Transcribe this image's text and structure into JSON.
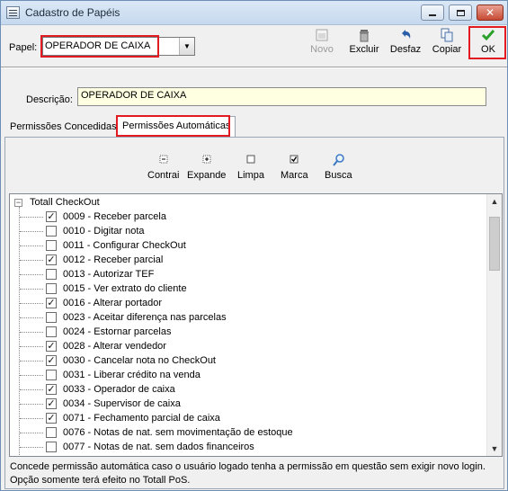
{
  "window": {
    "title": "Cadastro de Papéis"
  },
  "toolbar": {
    "papel_label": "Papel:",
    "papel_value": "OPERADOR DE CAIXA",
    "novo_label": "Novo",
    "excluir_label": "Excluir",
    "desfaz_label": "Desfaz",
    "copiar_label": "Copiar",
    "ok_label": "OK"
  },
  "descricao": {
    "label": "Descrição:",
    "value": "OPERADOR DE CAIXA"
  },
  "tabs": [
    {
      "label": "Permissões Concedidas"
    },
    {
      "label": "Permissões Automáticas"
    }
  ],
  "tree_toolbar": {
    "contrai": "Contrai",
    "expande": "Expande",
    "limpa": "Limpa",
    "marca": "Marca",
    "busca": "Busca"
  },
  "tree": {
    "root": "Totall CheckOut",
    "items": [
      {
        "label": "0009 - Receber parcela",
        "checked": true
      },
      {
        "label": "0010 - Digitar nota",
        "checked": false
      },
      {
        "label": "0011 - Configurar CheckOut",
        "checked": false
      },
      {
        "label": "0012 - Receber parcial",
        "checked": true
      },
      {
        "label": "0013 - Autorizar TEF",
        "checked": false
      },
      {
        "label": "0015 - Ver extrato do cliente",
        "checked": false
      },
      {
        "label": "0016 - Alterar portador",
        "checked": true
      },
      {
        "label": "0023 - Aceitar diferença nas parcelas",
        "checked": false
      },
      {
        "label": "0024 - Estornar parcelas",
        "checked": false
      },
      {
        "label": "0028 - Alterar vendedor",
        "checked": true
      },
      {
        "label": "0030 - Cancelar nota no CheckOut",
        "checked": true
      },
      {
        "label": "0031 - Liberar crédito na venda",
        "checked": false
      },
      {
        "label": "0033 - Operador de caixa",
        "checked": true
      },
      {
        "label": "0034 - Supervisor de caixa",
        "checked": true
      },
      {
        "label": "0071 - Fechamento parcial de caixa",
        "checked": true
      },
      {
        "label": "0076 - Notas de nat. sem movimentação de estoque",
        "checked": false
      },
      {
        "label": "0077 - Notas de nat. sem dados financeiros",
        "checked": false
      }
    ]
  },
  "hint": {
    "line1": "Concede permissão automática caso o usuário logado tenha a permissão em questão sem exigir novo login.",
    "line2": "Opção somente terá efeito no Totall PoS."
  }
}
